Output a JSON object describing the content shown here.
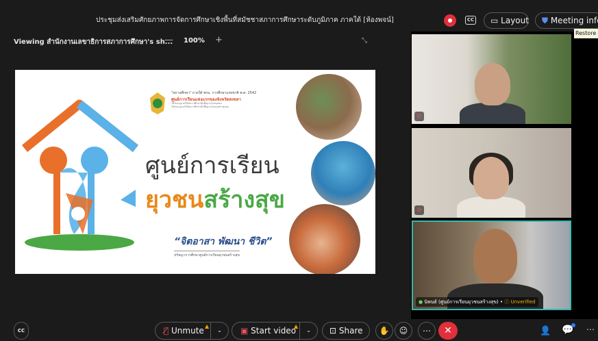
{
  "header": {
    "meeting_title": "ประชุมส่งเสริมศักยภาพการจัดการศึกษาเชิงพื้นที่สมัชชาสภาการศึกษาระดับภูมิภาค ภาคใต้ [ห้องพจน์]",
    "cc_label": "CC",
    "layout_label": "Layout",
    "meeting_info_label": "Meeting info",
    "restore_tooltip": "Restore U"
  },
  "share_bar": {
    "viewing_label": "Viewing สำนักงานเลขาธิการสภาการศึกษา's sh...",
    "zoom_minus": "—",
    "zoom_value": "100%",
    "zoom_plus": "+"
  },
  "slide": {
    "header_line1": "\"สถานศึกษา\" ภายใต้ พรบ. การศึกษาแห่งชาติ พ.ศ. 2542",
    "header_line2": "ศูนย์การเรียนแห่งแรกของจังหวัดสงขลา",
    "header_line3a": "ได้รับอนุญาตให้จัดการศึกษาขั้นพื้นฐานโดยบุคคล",
    "header_line3b": "ได้รับอนุญาตให้จัดการศึกษาขั้นพื้นฐานโดยองค์กรชุมชน",
    "title_line1": "ศูนย์การเรียน",
    "title_line2_part1": "ยุวชน",
    "title_line2_part2": "สร้างสุข",
    "quote": "“จิตอาสา พัฒนา ชีวิต”",
    "quote_sub": "ปรัชญาการศึกษาศูนย์การเรียนยุวชนสร้างสุข"
  },
  "participants": [
    {
      "name": "",
      "muted": true
    },
    {
      "name": "",
      "muted": true
    },
    {
      "name": "นิพนธ์ (ศูนย์การเรียนยุวชนสร้างสุข)",
      "status": "Unverified",
      "muted": false
    }
  ],
  "controls": {
    "cc_label": "CC",
    "unmute_label": "Unmute",
    "start_video_label": "Start video",
    "share_label": "Share",
    "caret": "⌄"
  },
  "colors": {
    "leave": "#e0303b",
    "active_speaker_border": "#37b8b0",
    "slide_orange": "#e8891a",
    "slide_green": "#4aa845"
  }
}
